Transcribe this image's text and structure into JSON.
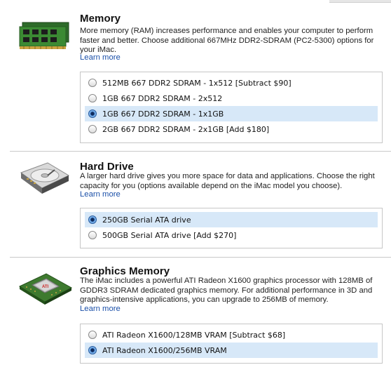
{
  "memory": {
    "title": "Memory",
    "description": "More memory (RAM) increases performance and enables your computer to perform faster and better. Choose additional 667MHz DDR2-SDRAM (PC2-5300) options for your iMac.",
    "learn_more": "Learn more",
    "options": [
      {
        "label": "512MB 667 DDR2 SDRAM - 1x512 [Subtract $90]",
        "selected": false
      },
      {
        "label": "1GB 667 DDR2 SDRAM - 2x512",
        "selected": false
      },
      {
        "label": "1GB 667 DDR2 SDRAM - 1x1GB",
        "selected": true
      },
      {
        "label": "2GB 667 DDR2 SDRAM - 2x1GB [Add $180]",
        "selected": false
      }
    ]
  },
  "hard_drive": {
    "title": "Hard Drive",
    "description": "A larger hard drive gives you more space for data and applications. Choose the right capacity for you (options available depend on the iMac model you choose).",
    "learn_more": "Learn more",
    "options": [
      {
        "label": "250GB Serial ATA drive",
        "selected": true
      },
      {
        "label": "500GB Serial ATA drive [Add $270]",
        "selected": false
      }
    ]
  },
  "graphics": {
    "title": "Graphics Memory",
    "description": "The iMac includes a powerful ATI Radeon X1600 graphics processor with 128MB of GDDR3 SDRAM dedicated graphics memory. For additional performance in 3D and graphics-intensive applications, you can upgrade to 256MB of memory.",
    "learn_more": "Learn more",
    "options": [
      {
        "label": "ATI Radeon X1600/128MB VRAM [Subtract $68]",
        "selected": false
      },
      {
        "label": "ATI Radeon X1600/256MB VRAM",
        "selected": true
      }
    ]
  },
  "colors": {
    "selected_row": "#d7e8f8",
    "link": "#1a4fa8"
  }
}
